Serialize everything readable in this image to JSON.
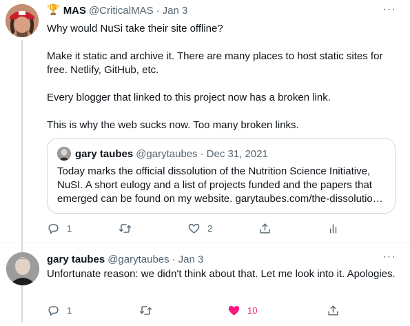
{
  "tweets": [
    {
      "badge": "🏆",
      "name": "MAS",
      "handle": "@CriticalMAS",
      "separator": "·",
      "date": "Jan 3",
      "more": "···",
      "paragraphs": [
        "Why would NuSi take their site offline?",
        "Make it static and archive it. There are many places to host static sites for free. Netlify, GitHub, etc.",
        "Every blogger that linked to this project now has a broken link.",
        "This is why the web sucks now. Too many broken links."
      ],
      "quote": {
        "name": "gary taubes",
        "handle": "@garytaubes",
        "separator": "·",
        "date": "Dec 31, 2021",
        "text": "Today marks the official dissolution of the Nutrition Science Initiative, NuSI. A short eulogy and a list of projects funded and the papers that emerged can be found on my website. garytaubes.com/the-dissolutio…"
      },
      "actions": {
        "replies": "1",
        "retweets": "",
        "likes": "2"
      }
    },
    {
      "name": "gary taubes",
      "handle": "@garytaubes",
      "separator": "·",
      "date": "Jan 3",
      "more": "···",
      "paragraphs": [
        "Unfortunate reason: we didn't think about that. Let me look into it. Apologies."
      ],
      "actions": {
        "replies": "1",
        "retweets": "",
        "likes": "10"
      }
    }
  ],
  "colors": {
    "text": "#0f1419",
    "secondary": "#536471",
    "border": "#cfd9de",
    "like_active": "#f91880"
  },
  "icons": [
    "reply-icon",
    "retweet-icon",
    "like-icon",
    "analytics-icon",
    "share-icon",
    "trophy-icon"
  ]
}
